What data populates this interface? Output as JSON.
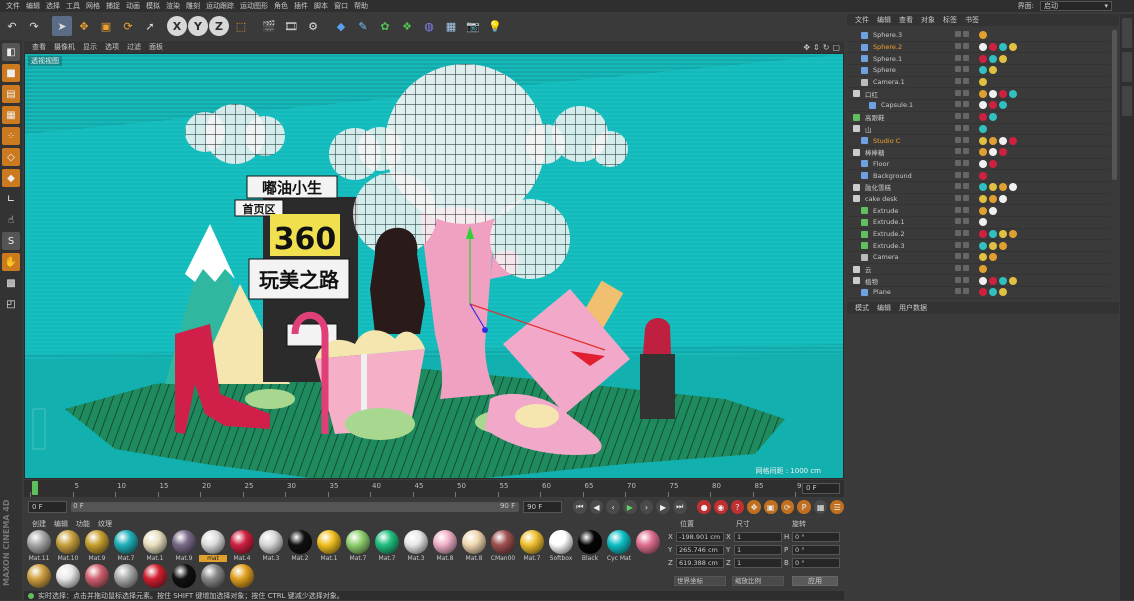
{
  "menu": [
    "文件",
    "编辑",
    "选择",
    "工具",
    "网格",
    "捕捉",
    "动画",
    "模拟",
    "渲染",
    "雕刻",
    "运动跟踪",
    "运动图形",
    "角色",
    "插件",
    "脚本",
    "窗口",
    "帮助"
  ],
  "layout": {
    "label": "界面:",
    "value": "启动"
  },
  "viewport_menu": [
    "查看",
    "摄像机",
    "显示",
    "选项",
    "过滤",
    "面板"
  ],
  "viewport": {
    "name": "透视视图",
    "grid_label": "网格间距 : 1000 cm"
  },
  "scene_text": {
    "sign1": "嘟油小生",
    "sign2": "首页区",
    "sign3": "360",
    "sign4": "玩美之路"
  },
  "axis_buttons": [
    "X",
    "Y",
    "Z"
  ],
  "timeline": {
    "ticks": [
      "0",
      "5",
      "10",
      "15",
      "20",
      "25",
      "30",
      "35",
      "40",
      "45",
      "50",
      "55",
      "60",
      "65",
      "70",
      "75",
      "80",
      "85",
      "90"
    ],
    "current": "0 F"
  },
  "transport": {
    "start": "0 F",
    "range_start": "0 F",
    "range_end": "90 F",
    "end": "90 F"
  },
  "material_menu": [
    "创建",
    "编辑",
    "功能",
    "纹理"
  ],
  "materials_row1": [
    {
      "name": "Mat.11",
      "color": "#a8a8a8"
    },
    {
      "name": "Mat.10",
      "color": "#c8a040"
    },
    {
      "name": "Mat.9",
      "color": "#c8a030"
    },
    {
      "name": "Mat.7",
      "color": "#20b0b8"
    },
    {
      "name": "Mat.1",
      "color": "#e8e0c0"
    },
    {
      "name": "Mat.9",
      "color": "#7a6a8a"
    },
    {
      "name": "mat",
      "color": "#dddddd"
    },
    {
      "name": "Mat.4",
      "color": "#d02040"
    },
    {
      "name": "Mat.3",
      "color": "#d8d8d8"
    },
    {
      "name": "Mat.2",
      "color": "#111111"
    },
    {
      "name": "Mat.1",
      "color": "#f0c020"
    },
    {
      "name": "Mat.7",
      "color": "#90d070"
    },
    {
      "name": "Mat.7",
      "color": "#20c080"
    },
    {
      "name": "Mat.3",
      "color": "#e8e8e8"
    },
    {
      "name": "Mat.8",
      "color": "#f0b0c8"
    },
    {
      "name": "Mat.8",
      "color": "#f0d8b0"
    },
    {
      "name": "CMan00",
      "color": "#a05050"
    },
    {
      "name": "Mat.7",
      "color": "#f0c030"
    },
    {
      "name": "Softbox",
      "color": "#ffffff"
    },
    {
      "name": "Black",
      "color": "#050505"
    },
    {
      "name": "Cyc Mat",
      "color": "#10c0c8"
    }
  ],
  "materials_row2": [
    {
      "name": "",
      "color": "#e07090"
    },
    {
      "name": "",
      "color": "#d0a040"
    },
    {
      "name": "",
      "color": "#e8e8e8"
    },
    {
      "name": "",
      "color": "#d06070"
    },
    {
      "name": "",
      "color": "#aaaaaa"
    },
    {
      "name": "",
      "color": "#d02030"
    },
    {
      "name": "",
      "color": "#111111"
    },
    {
      "name": "",
      "color": "#888888"
    },
    {
      "name": "",
      "color": "#e0a020"
    }
  ],
  "coords": {
    "headers": [
      "位置",
      "尺寸",
      "旋转"
    ],
    "rows": [
      {
        "ax": "X",
        "pos": "-198.901 cm",
        "sax": "X",
        "size": "1",
        "rax": "H",
        "rot": "0 °"
      },
      {
        "ax": "Y",
        "pos": "265.746 cm",
        "sax": "Y",
        "size": "1",
        "rax": "P",
        "rot": "0 °"
      },
      {
        "ax": "Z",
        "pos": "619.388 cm",
        "sax": "Z",
        "size": "1",
        "rax": "B",
        "rot": "0 °"
      }
    ],
    "mode1": "世界坐标",
    "mode2": "缩放比例",
    "apply": "应用"
  },
  "status": "实时选择：点击并拖动鼠标选择元素。按住 SHIFT 键增加选择对象；按住 CTRL 键减少选择对象。",
  "object_menu": [
    "文件",
    "编辑",
    "查看",
    "对象",
    "标签",
    "书签"
  ],
  "objects": [
    {
      "name": "Sphere.3",
      "indent": 1,
      "icon": "#6fa0e0",
      "hl": false
    },
    {
      "name": "Sphere.2",
      "indent": 1,
      "icon": "#6fa0e0",
      "hl": true
    },
    {
      "name": "Sphere.1",
      "indent": 1,
      "icon": "#6fa0e0",
      "hl": false
    },
    {
      "name": "Sphere",
      "indent": 1,
      "icon": "#6fa0e0",
      "hl": false
    },
    {
      "name": "Camera.1",
      "indent": 1,
      "icon": "#bbbbbb",
      "hl": false
    },
    {
      "name": "口红",
      "indent": 0,
      "icon": "#cccccc",
      "hl": false
    },
    {
      "name": "Capsule.1",
      "indent": 2,
      "icon": "#6fa0e0",
      "hl": false
    },
    {
      "name": "高跟鞋",
      "indent": 0,
      "icon": "#60c060",
      "hl": false
    },
    {
      "name": "山",
      "indent": 0,
      "icon": "#cccccc",
      "hl": false
    },
    {
      "name": "Studio C",
      "indent": 1,
      "icon": "#6fa0e0",
      "hl": true
    },
    {
      "name": "棒棒糖",
      "indent": 0,
      "icon": "#cccccc",
      "hl": false
    },
    {
      "name": "Floor",
      "indent": 1,
      "icon": "#6fa0e0",
      "hl": false
    },
    {
      "name": "Background",
      "indent": 1,
      "icon": "#6fa0e0",
      "hl": false
    },
    {
      "name": "融化雪糕",
      "indent": 0,
      "icon": "#cccccc",
      "hl": false
    },
    {
      "name": "cake desk",
      "indent": 0,
      "icon": "#cccccc",
      "hl": false
    },
    {
      "name": "Extrude",
      "indent": 1,
      "icon": "#60c060",
      "hl": false
    },
    {
      "name": "Extrude.1",
      "indent": 1,
      "icon": "#60c060",
      "hl": false
    },
    {
      "name": "Extrude.2",
      "indent": 1,
      "icon": "#60c060",
      "hl": false
    },
    {
      "name": "Extrude.3",
      "indent": 1,
      "icon": "#60c060",
      "hl": false
    },
    {
      "name": "Camera",
      "indent": 1,
      "icon": "#bbbbbb",
      "hl": false
    },
    {
      "name": "云",
      "indent": 0,
      "icon": "#cccccc",
      "hl": false
    },
    {
      "name": "植物",
      "indent": 0,
      "icon": "#cccccc",
      "hl": false
    },
    {
      "name": "Plane",
      "indent": 1,
      "icon": "#6fa0e0",
      "hl": false
    }
  ],
  "attr_menu": [
    "模式",
    "编辑",
    "用户数据"
  ],
  "brand": "MAXON CINEMA 4D"
}
